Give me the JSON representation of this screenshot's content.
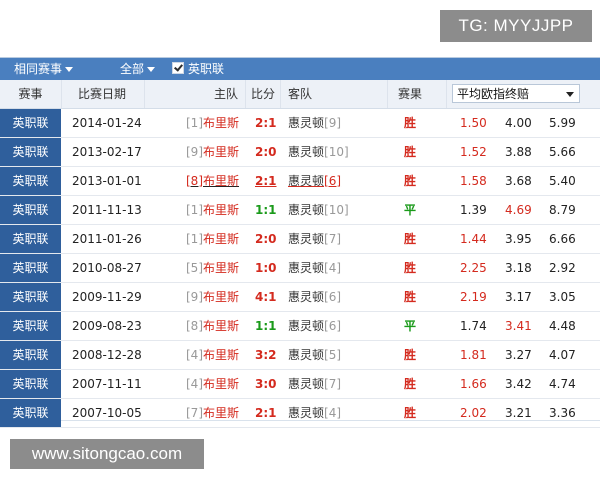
{
  "badge": {
    "text": "TG: MYYJJPP"
  },
  "watermark": {
    "text": "www.sitongcao.com"
  },
  "filter_bar": {
    "same_league_label": "相同赛事",
    "all_label": "全部",
    "league_filter_label": "英职联",
    "league_filter_checked": true
  },
  "table": {
    "headers": {
      "league": "赛事",
      "date": "比赛日期",
      "home": "主队",
      "score": "比分",
      "away": "客队",
      "result": "赛果",
      "odds_select": "平均欧指终赔"
    },
    "rows": [
      {
        "league": "英职联",
        "date": "2014-01-24",
        "home_rank": "[1]",
        "home": "布里斯",
        "score": "2:1",
        "away": "惠灵顿",
        "away_rank": "[9]",
        "result": "胜",
        "odd1": "1.50",
        "odd2": "4.00",
        "odd3": "5.99",
        "highlight": "odd1"
      },
      {
        "league": "英职联",
        "date": "2013-02-17",
        "home_rank": "[9]",
        "home": "布里斯",
        "score": "2:0",
        "away": "惠灵顿",
        "away_rank": "[10]",
        "result": "胜",
        "odd1": "1.52",
        "odd2": "3.88",
        "odd3": "5.66",
        "highlight": "odd1"
      },
      {
        "league": "英职联",
        "date": "2013-01-01",
        "home_rank": "[8]",
        "home": "布里斯",
        "score": "2:1",
        "away": "惠灵顿",
        "away_rank": "[6]",
        "result": "胜",
        "odd1": "1.58",
        "odd2": "3.68",
        "odd3": "5.40",
        "highlight": "odd1",
        "underlined": true
      },
      {
        "league": "英职联",
        "date": "2011-11-13",
        "home_rank": "[1]",
        "home": "布里斯",
        "score": "1:1",
        "away": "惠灵顿",
        "away_rank": "[10]",
        "result": "平",
        "odd1": "1.39",
        "odd2": "4.69",
        "odd3": "8.79",
        "highlight": "odd2"
      },
      {
        "league": "英职联",
        "date": "2011-01-26",
        "home_rank": "[1]",
        "home": "布里斯",
        "score": "2:0",
        "away": "惠灵顿",
        "away_rank": "[7]",
        "result": "胜",
        "odd1": "1.44",
        "odd2": "3.95",
        "odd3": "6.66",
        "highlight": "odd1"
      },
      {
        "league": "英职联",
        "date": "2010-08-27",
        "home_rank": "[5]",
        "home": "布里斯",
        "score": "1:0",
        "away": "惠灵顿",
        "away_rank": "[4]",
        "result": "胜",
        "odd1": "2.25",
        "odd2": "3.18",
        "odd3": "2.92",
        "highlight": "odd1"
      },
      {
        "league": "英职联",
        "date": "2009-11-29",
        "home_rank": "[9]",
        "home": "布里斯",
        "score": "4:1",
        "away": "惠灵顿",
        "away_rank": "[6]",
        "result": "胜",
        "odd1": "2.19",
        "odd2": "3.17",
        "odd3": "3.05",
        "highlight": "odd1"
      },
      {
        "league": "英职联",
        "date": "2009-08-23",
        "home_rank": "[8]",
        "home": "布里斯",
        "score": "1:1",
        "away": "惠灵顿",
        "away_rank": "[6]",
        "result": "平",
        "odd1": "1.74",
        "odd2": "3.41",
        "odd3": "4.48",
        "highlight": "odd2"
      },
      {
        "league": "英职联",
        "date": "2008-12-28",
        "home_rank": "[4]",
        "home": "布里斯",
        "score": "3:2",
        "away": "惠灵顿",
        "away_rank": "[5]",
        "result": "胜",
        "odd1": "1.81",
        "odd2": "3.27",
        "odd3": "4.07",
        "highlight": "odd1"
      },
      {
        "league": "英职联",
        "date": "2007-11-11",
        "home_rank": "[4]",
        "home": "布里斯",
        "score": "3:0",
        "away": "惠灵顿",
        "away_rank": "[7]",
        "result": "胜",
        "odd1": "1.66",
        "odd2": "3.42",
        "odd3": "4.74",
        "highlight": "odd1"
      },
      {
        "league": "英职联",
        "date": "2007-10-05",
        "home_rank": "[7]",
        "home": "布里斯",
        "score": "2:1",
        "away": "惠灵顿",
        "away_rank": "[4]",
        "result": "胜",
        "odd1": "2.02",
        "odd2": "3.21",
        "odd3": "3.36",
        "highlight": "odd1"
      }
    ]
  },
  "colors": {
    "header_bar": "#4a7fbf",
    "league_cell": "#2f5f9c",
    "win_red": "#d42a1e",
    "draw_green": "#1a9a1a"
  }
}
